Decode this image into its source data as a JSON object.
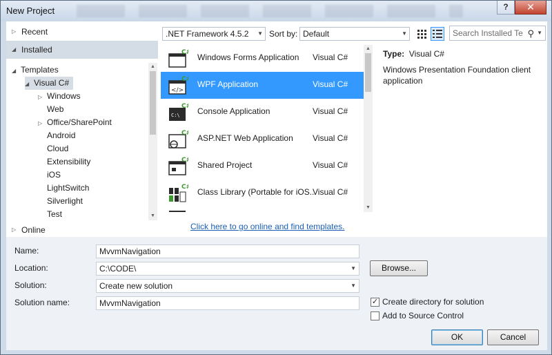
{
  "window": {
    "title": "New Project",
    "help_label": "?",
    "close_label": "✕"
  },
  "nav": {
    "recent": "Recent",
    "installed": "Installed",
    "online": "Online",
    "tree": [
      {
        "label": "Templates",
        "arrow": "◢",
        "indent": 0
      },
      {
        "label": "Visual C#",
        "arrow": "◢",
        "indent": 1,
        "selected": true
      },
      {
        "label": "Windows",
        "arrow": "▷",
        "indent": 2
      },
      {
        "label": "Web",
        "arrow": "",
        "indent": 2
      },
      {
        "label": "Office/SharePoint",
        "arrow": "▷",
        "indent": 2
      },
      {
        "label": "Android",
        "arrow": "",
        "indent": 2
      },
      {
        "label": "Cloud",
        "arrow": "",
        "indent": 2
      },
      {
        "label": "Extensibility",
        "arrow": "",
        "indent": 2
      },
      {
        "label": "iOS",
        "arrow": "",
        "indent": 2
      },
      {
        "label": "LightSwitch",
        "arrow": "",
        "indent": 2
      },
      {
        "label": "Silverlight",
        "arrow": "",
        "indent": 2
      },
      {
        "label": "Test",
        "arrow": "",
        "indent": 2
      }
    ]
  },
  "toolbar": {
    "framework": ".NET Framework 4.5.2",
    "sort_by_label": "Sort by:",
    "sort_value": "Default",
    "search_placeholder": "Search Installed Te"
  },
  "templates": [
    {
      "name": "Windows Forms Application",
      "lang": "Visual C#",
      "icon": "windows-forms-icon"
    },
    {
      "name": "WPF Application",
      "lang": "Visual C#",
      "icon": "wpf-icon",
      "selected": true
    },
    {
      "name": "Console Application",
      "lang": "Visual C#",
      "icon": "console-icon"
    },
    {
      "name": "ASP.NET Web Application",
      "lang": "Visual C#",
      "icon": "web-app-icon"
    },
    {
      "name": "Shared Project",
      "lang": "Visual C#",
      "icon": "shared-project-icon"
    },
    {
      "name": "Class Library (Portable for iOS...",
      "lang": "Visual C#",
      "icon": "class-library-icon"
    }
  ],
  "description": {
    "type_label": "Type:",
    "type_value": "Visual C#",
    "text": "Windows Presentation Foundation client application"
  },
  "online_link": "Click here to go online and find templates.",
  "form": {
    "name_label": "Name:",
    "name_value": "MvvmNavigation",
    "location_label": "Location:",
    "location_value": "C:\\CODE\\",
    "solution_label": "Solution:",
    "solution_value": "Create new solution",
    "solution_name_label": "Solution name:",
    "solution_name_value": "MvvmNavigation",
    "browse_label": "Browse...",
    "create_dir_label": "Create directory for solution",
    "create_dir_checked": true,
    "source_control_label": "Add to Source Control",
    "source_control_checked": false,
    "ok_label": "OK",
    "cancel_label": "Cancel"
  },
  "colors": {
    "selection": "#3399ff",
    "accent_green": "#3c9a2e",
    "link": "#1a5fb4"
  }
}
